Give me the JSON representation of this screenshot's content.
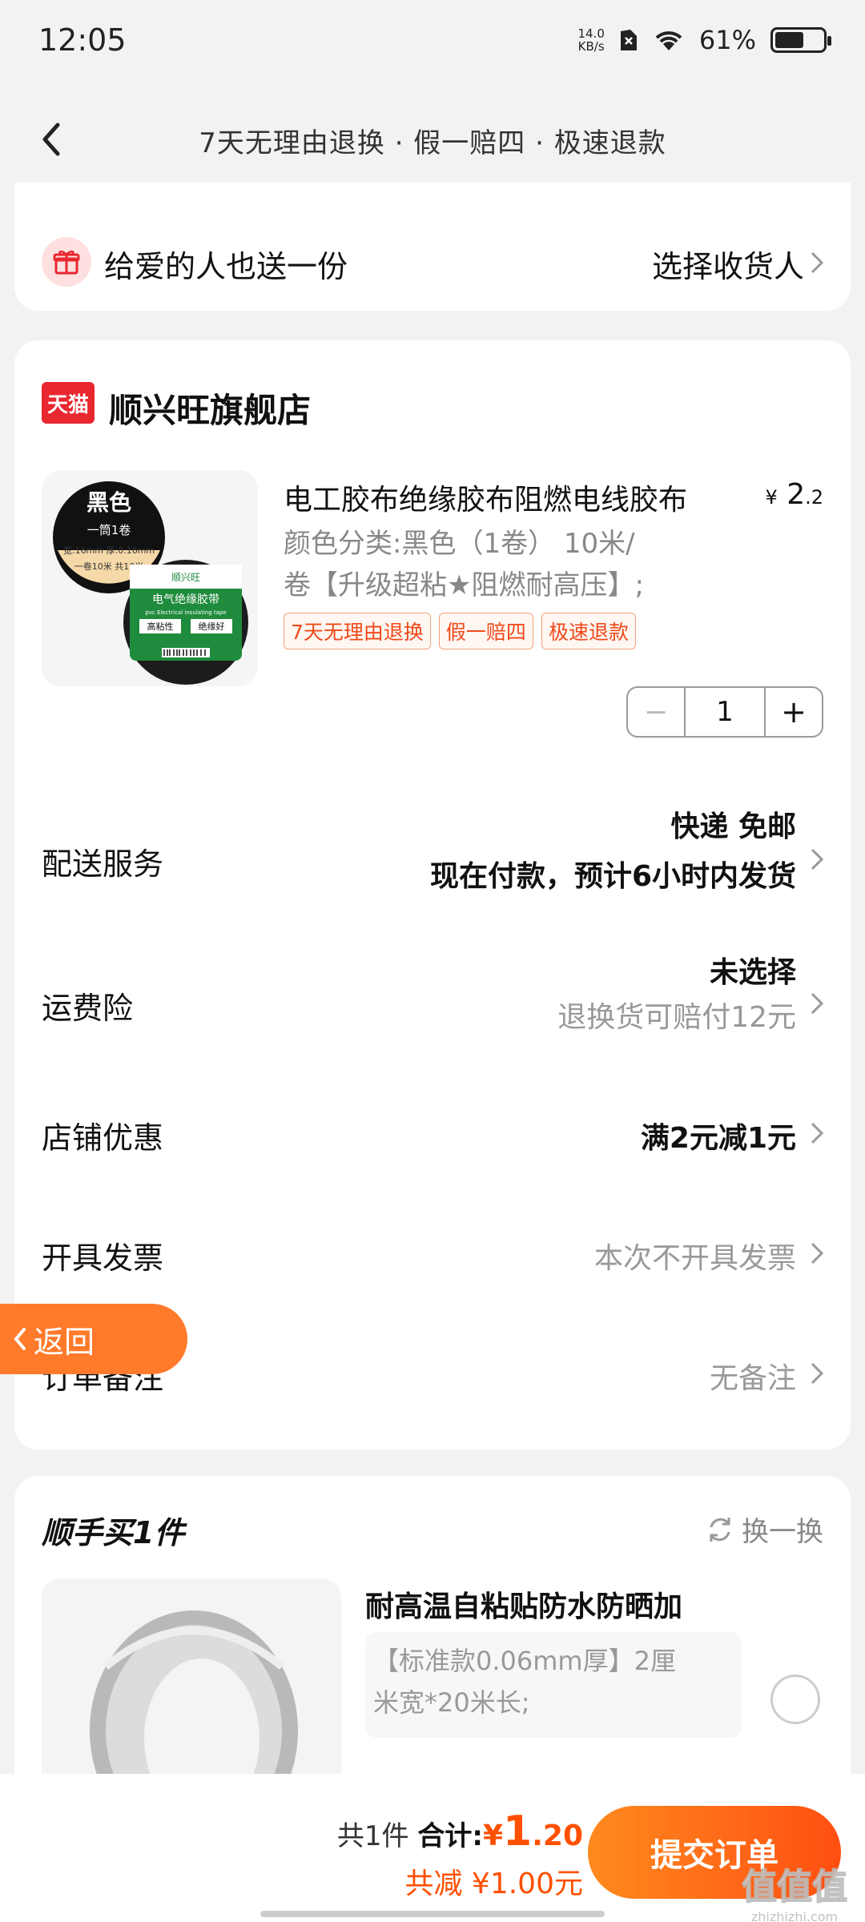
{
  "status": {
    "time": "12:05",
    "net_speed_value": "14.0",
    "net_speed_unit": "KB/s",
    "battery_pct": "61%",
    "battery_level": 0.61
  },
  "header": {
    "title": "7天无理由退换 · 假一赔四 · 极速退款"
  },
  "gift": {
    "text": "给爱的人也送一份",
    "link": "选择收货人"
  },
  "store": {
    "badge": "天猫",
    "name": "顺兴旺旗舰店"
  },
  "product": {
    "title": "电工胶布绝缘胶布阻燃电线胶布",
    "price_symbol": "¥",
    "price_int": "2",
    "price_dec": ".2",
    "spec_line1": "颜色分类:黑色（1卷） 10米/",
    "spec_line2": "卷【升级超粘★阻燃耐高压】;",
    "tags": [
      "7天无理由退换",
      "假一赔四",
      "极速退款"
    ],
    "quantity": "1",
    "img_badge_1": "黑色",
    "img_badge_2": "一筒1卷",
    "img_size": "宽:16mm 厚:0.16mm",
    "img_len": "一卷10米 共10米",
    "img_brand": "顺兴旺",
    "img_tape_name": "电气绝缘胶带",
    "img_tape_en": "pvc Electrical insulating tape",
    "img_feat1": "高粘性",
    "img_feat2": "绝缘好"
  },
  "rows": {
    "delivery_label": "配送服务",
    "delivery_line1": "快递 免邮",
    "delivery_line2": "现在付款，预计6小时内发货",
    "insurance_label": "运费险",
    "insurance_line1": "未选择",
    "insurance_line2": "退换货可赔付12元",
    "coupon_label": "店铺优惠",
    "coupon_value": "满2元减1元",
    "invoice_label": "开具发票",
    "invoice_value": "本次不开具发票",
    "note_label": "订单备注",
    "note_value": "无备注"
  },
  "float_back": {
    "label": "返回"
  },
  "recommend": {
    "title": "顺手买1件",
    "switch_label": "换一换",
    "name": "耐高温自粘贴防水防晒加",
    "spec_line1": "【标准款0.06mm厚】2厘",
    "spec_line2": "米宽*20米长;"
  },
  "footer": {
    "count": "共1件",
    "total_label": "合计:",
    "total_symbol": "¥",
    "total_int": "1",
    "total_dec": ".20",
    "savings": "共减 ¥1.00元",
    "submit": "提交订单"
  },
  "watermark": {
    "logo": "值值值",
    "url": "zhizhizhi.com"
  },
  "colors": {
    "accent": "#ff5000",
    "tmall_red": "#e8272f",
    "float_orange": "#ff7a2a"
  }
}
